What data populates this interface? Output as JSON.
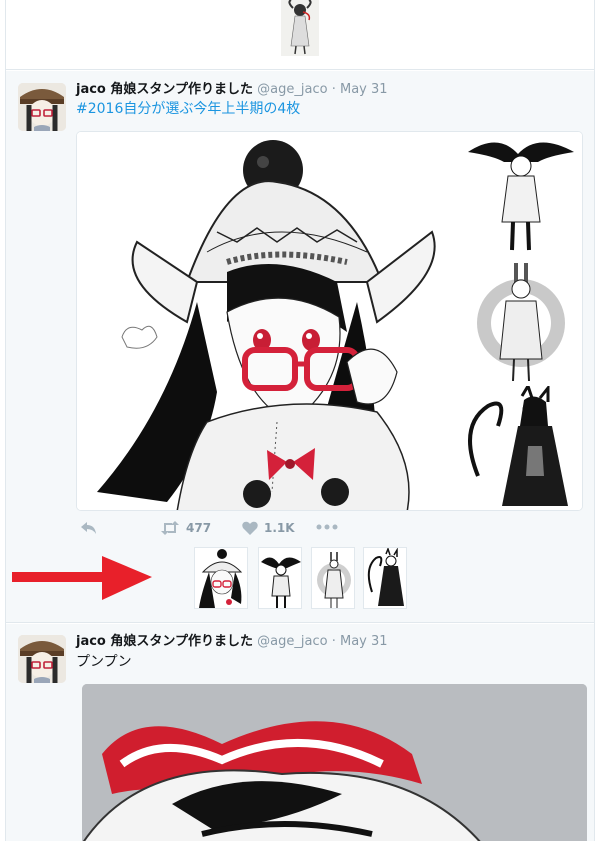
{
  "tweets": [
    {
      "name": "jaco 角娘スタンプ作りました",
      "handle": "@age_jaco",
      "dot": "·",
      "date": "May 31",
      "text": "#2016自分が選ぶ今年上半期の4枚",
      "retweets": "477",
      "likes": "1.1K"
    },
    {
      "name": "jaco 角娘スタンプ作りました",
      "handle": "@age_jaco",
      "dot": "·",
      "date": "May 31",
      "text": "プンプン"
    }
  ],
  "icons": {
    "reply": "reply-icon",
    "retweet": "retweet-icon",
    "like": "heart-icon",
    "more": "more-icon",
    "annotation_arrow": "red-arrow-icon"
  },
  "colors": {
    "hashtag": "#1b95e0",
    "muted": "#8899a6",
    "highlight_bg": "#f5f8fa",
    "arrow": "#e8202a",
    "glasses": "#d4213a"
  }
}
